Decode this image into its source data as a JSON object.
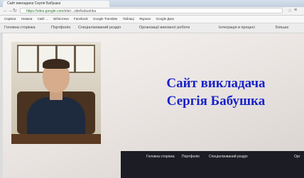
{
  "browser": {
    "tab_title": "Сайт викладача Сергія Бабушка",
    "url_host": "https://sites.google.com",
    "url_path": "/site/...site/babushka",
    "bookmarks": [
      "Сервіси",
      "Новини",
      "Сайт ...",
      "Бібліотека",
      "Facebook",
      "Google Translate",
      "Таблиці",
      "Журнал",
      "Google Диск"
    ]
  },
  "site_nav": {
    "items": [
      "Головна сторінка",
      "Портфоліо",
      "Спеціалізований розділ",
      "Організації виховної роботи",
      "Інтеграція в процесі",
      "Більше"
    ]
  },
  "hero": {
    "title_line1": "Сайт викладача",
    "title_line2": "Сергія Бабушка"
  },
  "site_nav_overlay": {
    "items": [
      "Головна сторінка",
      "Портфоліо",
      "Спеціалізований розділ",
      "Орг"
    ]
  }
}
